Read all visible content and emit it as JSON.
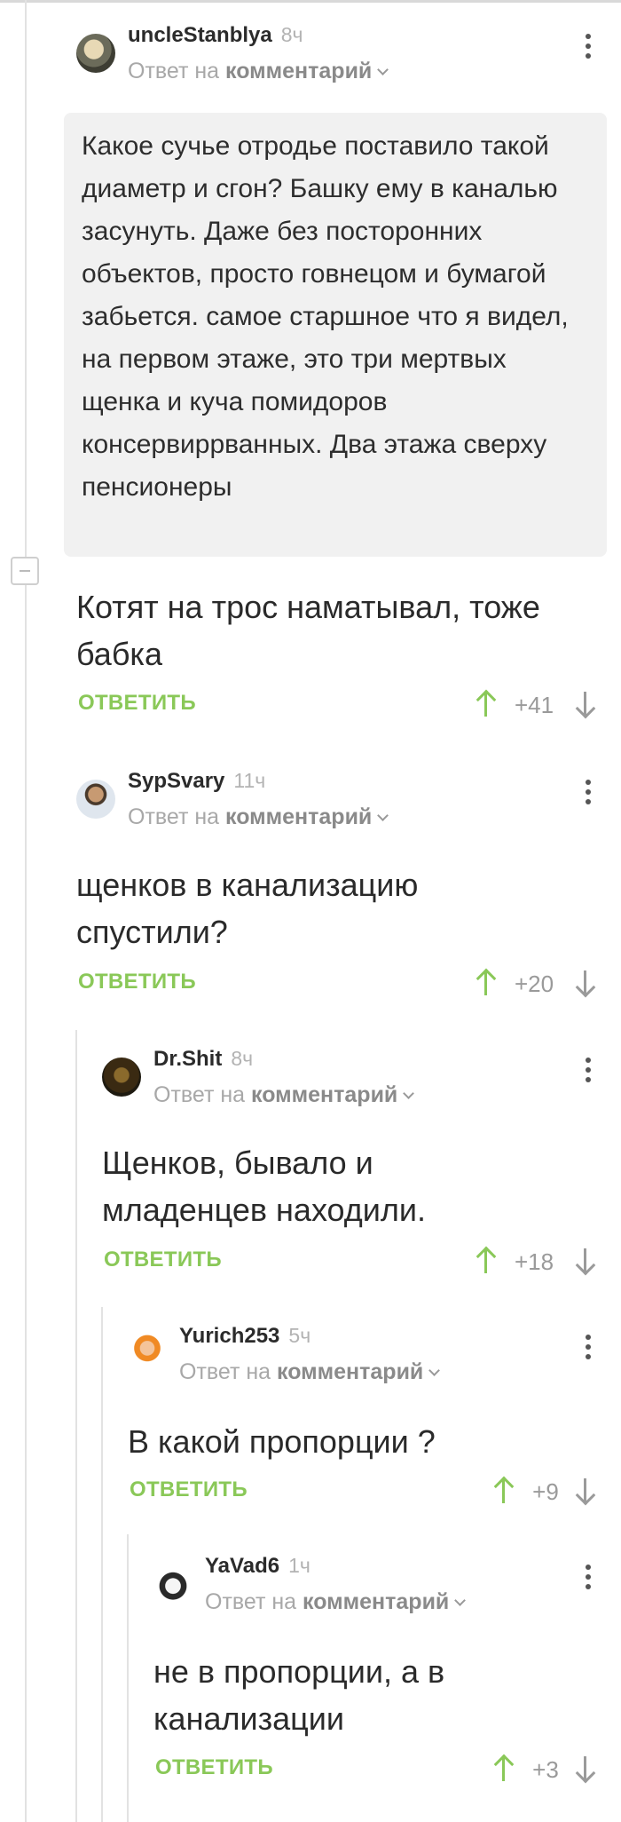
{
  "labels": {
    "reply_to_prefix": "Ответ на",
    "reply_to_link": "комментарий",
    "reply_button": "ОТВЕТИТЬ"
  },
  "colors": {
    "accent_green": "#8ac858",
    "muted_gray": "#9a9a9a"
  },
  "comments": [
    {
      "author": "uncleStanblya",
      "time": "8ч",
      "quote": "Какое сучье отродье поставило такой диаметр и сгон? Башку ему в каналью засунуть. Даже без посторонних объектов, просто говнецом и бумагой забьется. самое старшное что я видел, на первом этаже, это три мертвых щенка и куча помидоров консервиррванных. Два этажа сверху пенсионеры",
      "text": "Котят на трос наматывал, тоже бабка",
      "score": "+41"
    },
    {
      "author": "SypSvary",
      "time": "11ч",
      "text": "щенков в канализацию спустили?",
      "score": "+20"
    },
    {
      "author": "Dr.Shit",
      "time": "8ч",
      "text": "Щенков, бывало и младенцев находили.",
      "score": "+18"
    },
    {
      "author": "Yurich253",
      "time": "5ч",
      "text": "В какой пропорции ?",
      "score": "+9"
    },
    {
      "author": "YaVad6",
      "time": "1ч",
      "text": "не в пропорции, а в канализации",
      "score": "+3"
    }
  ]
}
